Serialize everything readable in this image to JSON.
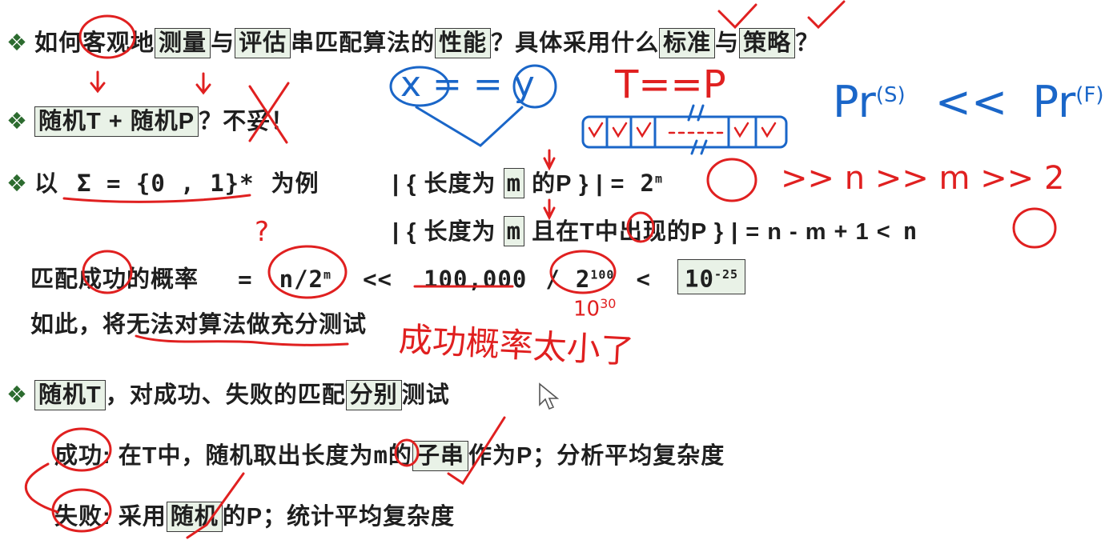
{
  "slide": {
    "line1": {
      "bullet": "❖",
      "a": "如何",
      "b": "客观",
      "c": "地",
      "d": "测量",
      "e": "与",
      "f": "评估",
      "g": "串匹配算法的",
      "h": "性能",
      "i": "？具体采用什么",
      "j": "标准",
      "k": "与",
      "l": "策略",
      "m": "？"
    },
    "line2": {
      "bullet": "❖",
      "box_text": "随机T + 随机P",
      "tail": "？不妥！"
    },
    "line3": {
      "bullet": "❖",
      "a": "以",
      "sigma": "Σ = {0 , 1}*",
      "b": "为例",
      "set1_open": "| { 长度为",
      "set1_m": "m",
      "set1_close": "的P } | =",
      "pow_base": "2",
      "pow_exp": "m"
    },
    "line4": {
      "open": "| { 长度为",
      "m": "m",
      "a": "且在",
      "t": "T",
      "b": "中出现的P } | = n - m + 1 <",
      "n": "n"
    },
    "line5": {
      "label": "匹配成功的概率",
      "eq": "=",
      "ratio_n": "n/2",
      "ratio_exp": "m",
      "lt1": "<<",
      "num": "100,000",
      "slash": "/",
      "pow_base": "2",
      "pow_exp": "100",
      "lt2": "<",
      "result_base": "10",
      "result_exp": "-25"
    },
    "line6": {
      "text": "如此，将无法对算法做充分测试"
    },
    "line7": {
      "bullet": "❖",
      "box1": "随机T",
      "a": "，对成功、失败的匹配",
      "box2": "分别",
      "b": "测试"
    },
    "line8": {
      "label": "成功",
      "a": ": 在T中，随机取出长度为",
      "m": "m",
      "b": "的",
      "box": "子串",
      "c": "作为P；分析平均复杂度"
    },
    "line9": {
      "label": "失败",
      "a": ": 采用",
      "box": "随机",
      "b": "的P；统计平均复杂度"
    }
  },
  "annotations": {
    "xy": "x = = y",
    "tp": "T==P",
    "pr_s": "Pr",
    "pr_s_sup": "(S)",
    "pr_ll": "<<",
    "pr_f": "Pr",
    "pr_f_sup": "(F)",
    "nmm": ">>  n >> m >> 2",
    "question": "?",
    "ten30": "10",
    "ten30_sup": "30",
    "note": "成功概率太小了"
  },
  "colors": {
    "bullet": "#2c6b2f",
    "box_fill": "#e9f2e7",
    "red_ink": "#e02020",
    "blue_ink": "#1a66c8"
  }
}
